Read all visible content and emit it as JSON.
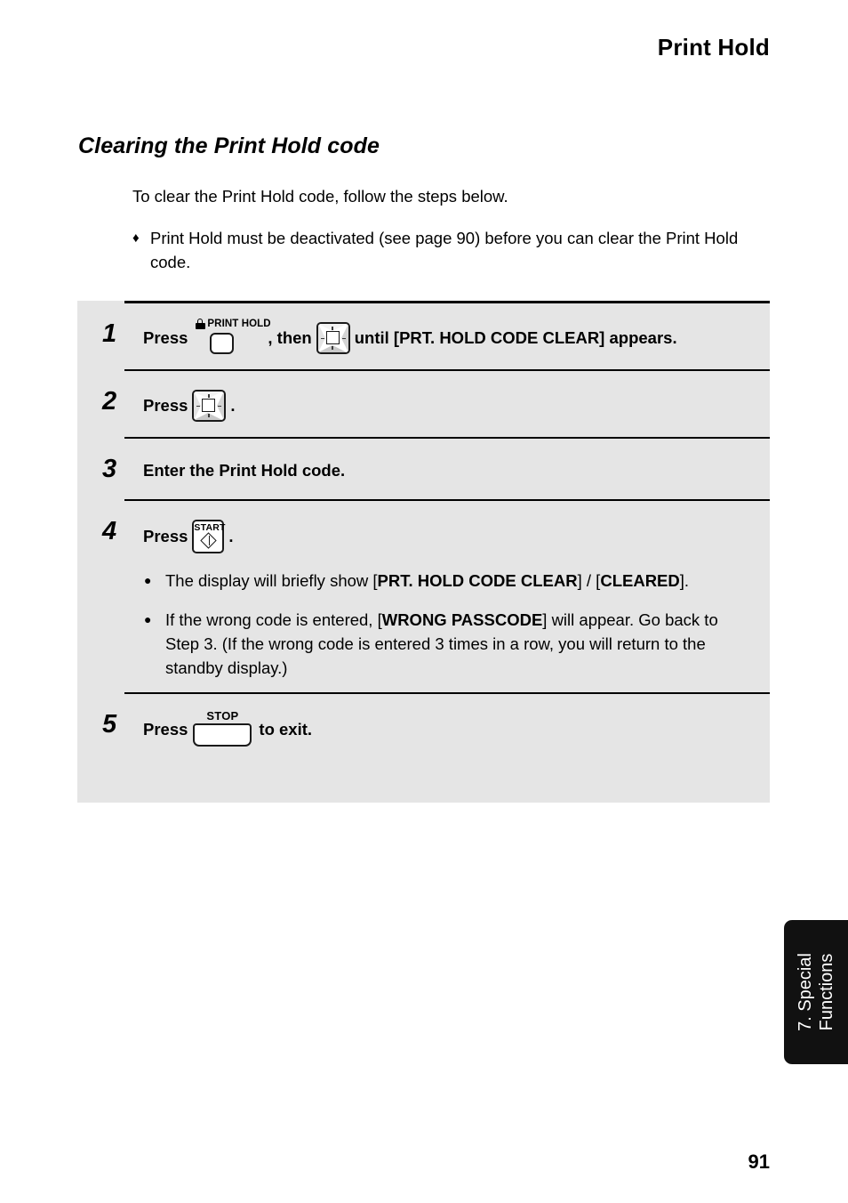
{
  "header": {
    "title": "Print Hold"
  },
  "section": {
    "heading": "Clearing the Print Hold code",
    "intro": "To clear the Print Hold code, follow the steps below.",
    "note_bullet": "♦",
    "note_text": "Print Hold must be deactivated (see page 90) before you can clear the Print Hold code."
  },
  "steps": {
    "step1": {
      "number": "1",
      "press_label": "Press",
      "printhold_icon_label": "PRINT HOLD",
      "then_label": ", then",
      "tail": "until [PRT. HOLD CODE CLEAR] appears."
    },
    "step2": {
      "number": "2",
      "press_label": "Press",
      "period": "."
    },
    "step3": {
      "number": "3",
      "text": "Enter the Print Hold code."
    },
    "step4": {
      "number": "4",
      "press_label": "Press",
      "start_icon_label": "START",
      "period": ".",
      "bullet_glyph": "●",
      "bullets": [
        {
          "part1": "The display will briefly show [",
          "bold1": "PRT. HOLD CODE CLEAR",
          "part2": "] / [",
          "bold2": "CLEARED",
          "part3": "]."
        },
        {
          "part1": "If the wrong code is entered, [",
          "bold1": "WRONG PASSCODE",
          "part2": "] will appear. Go back to Step 3. (If the wrong code is entered 3 times in a row, you will return to the standby display.)"
        }
      ]
    },
    "step5": {
      "number": "5",
      "press_label": "Press",
      "stop_icon_label": "STOP",
      "tail": "to exit."
    }
  },
  "side_tab": {
    "line1": "7. Special",
    "line2": "Functions"
  },
  "footer": {
    "page_number": "91"
  },
  "colors": {
    "panel_background": "#e5e5e5",
    "rule": "#000000",
    "side_tab_background": "#111111",
    "page_background": "#ffffff"
  }
}
